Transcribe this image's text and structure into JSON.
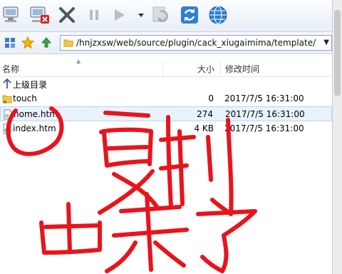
{
  "address": {
    "path": "/hnjzxsw/web/source/plugin/cack_xiugaimima/template/"
  },
  "columns": {
    "name": "名称",
    "size": "大小",
    "modified": "修改时间"
  },
  "parent_dir_label": "上级目录",
  "files": [
    {
      "name": "touch",
      "size": "0",
      "modified": "2017/7/5 16:31:00",
      "icon": "folder-icon"
    },
    {
      "name": "home.htm",
      "size": "274",
      "modified": "2017/7/5 16:31:00",
      "icon": "html-file-icon"
    },
    {
      "name": "index.htm",
      "size": "4 KB",
      "modified": "2017/7/5 16:31:00",
      "icon": "html-file-icon"
    }
  ],
  "annotation": {
    "text": "复制出来了",
    "color": "#e8141c"
  },
  "colors": {
    "toolbar_bg": "#e8eef7",
    "selection": "#e9f2fd",
    "annotation": "#e8141c"
  }
}
